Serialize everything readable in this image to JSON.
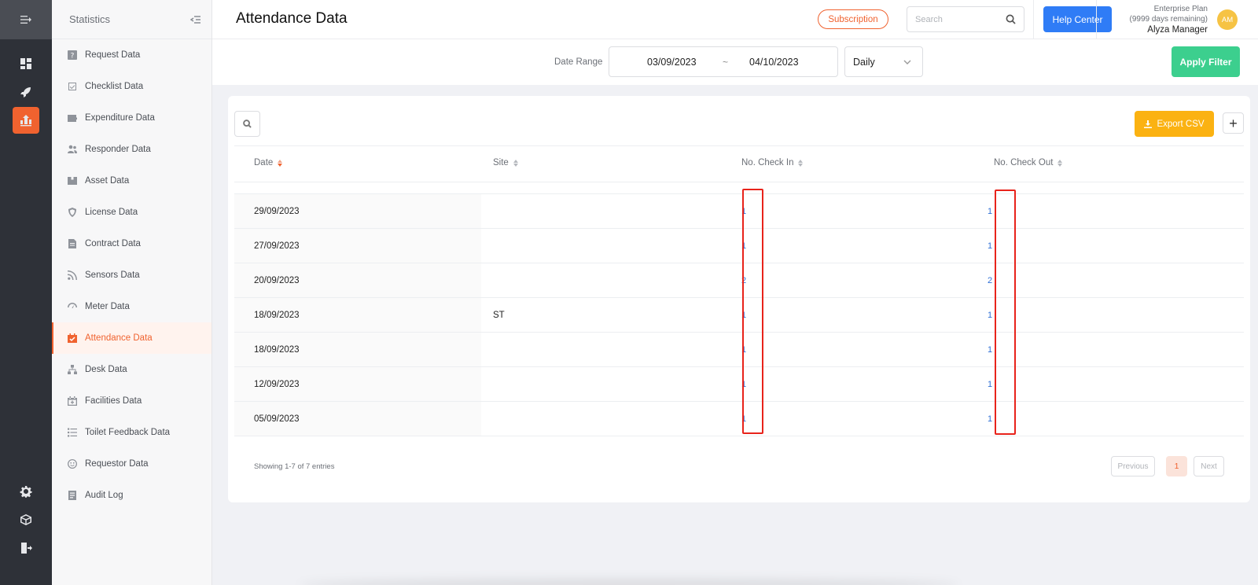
{
  "sidebar": {
    "title": "Statistics",
    "items": [
      {
        "label": "Request Data",
        "icon": "question-square-icon"
      },
      {
        "label": "Checklist Data",
        "icon": "checklist-icon"
      },
      {
        "label": "Expenditure Data",
        "icon": "wallet-icon"
      },
      {
        "label": "Responder Data",
        "icon": "users-icon"
      },
      {
        "label": "Asset Data",
        "icon": "box-icon"
      },
      {
        "label": "License Data",
        "icon": "shield-icon"
      },
      {
        "label": "Contract Data",
        "icon": "document-icon"
      },
      {
        "label": "Sensors Data",
        "icon": "rss-icon"
      },
      {
        "label": "Meter Data",
        "icon": "gauge-icon"
      },
      {
        "label": "Attendance Data",
        "icon": "calendar-check-icon",
        "active": true
      },
      {
        "label": "Desk Data",
        "icon": "sitemap-icon"
      },
      {
        "label": "Facilities Data",
        "icon": "calendar-plus-icon"
      },
      {
        "label": "Toilet Feedback Data",
        "icon": "list-icon"
      },
      {
        "label": "Requestor Data",
        "icon": "smile-icon"
      },
      {
        "label": "Audit Log",
        "icon": "log-icon"
      }
    ]
  },
  "header": {
    "title": "Attendance Data",
    "subscription_label": "Subscription",
    "search_placeholder": "Search",
    "help_label": "Help Center",
    "plan_name": "Enterprise Plan",
    "plan_remaining": "(9999 days remaining)",
    "user_name": "Alyza Manager",
    "avatar_initials": "AM"
  },
  "filter": {
    "date_range_label": "Date Range",
    "start_date": "03/09/2023",
    "separator": "~",
    "end_date": "04/10/2023",
    "period": "Daily",
    "apply_label": "Apply Filter"
  },
  "table": {
    "export_label": "Export CSV",
    "add_label": "+",
    "columns": [
      "Date",
      "Site",
      "No. Check In",
      "No. Check Out"
    ],
    "rows": [
      {
        "date": "29/09/2023",
        "site": "",
        "check_in": "1",
        "check_out": "1"
      },
      {
        "date": "27/09/2023",
        "site": "",
        "check_in": "1",
        "check_out": "1"
      },
      {
        "date": "20/09/2023",
        "site": "",
        "check_in": "2",
        "check_out": "2"
      },
      {
        "date": "18/09/2023",
        "site": "ST",
        "check_in": "1",
        "check_out": "1"
      },
      {
        "date": "18/09/2023",
        "site": "",
        "check_in": "1",
        "check_out": "1"
      },
      {
        "date": "12/09/2023",
        "site": "",
        "check_in": "1",
        "check_out": "1"
      },
      {
        "date": "05/09/2023",
        "site": "",
        "check_in": "1",
        "check_out": "1"
      }
    ]
  },
  "pagination": {
    "entries_text": "Showing 1-7 of 7 entries",
    "previous_label": "Previous",
    "current_page": "1",
    "next_label": "Next"
  },
  "colors": {
    "accent": "#f0622f",
    "help_blue": "#2f7cf6",
    "apply_green": "#3ccf8e",
    "export_yellow": "#fbb212",
    "highlight_red": "#e8231b"
  }
}
